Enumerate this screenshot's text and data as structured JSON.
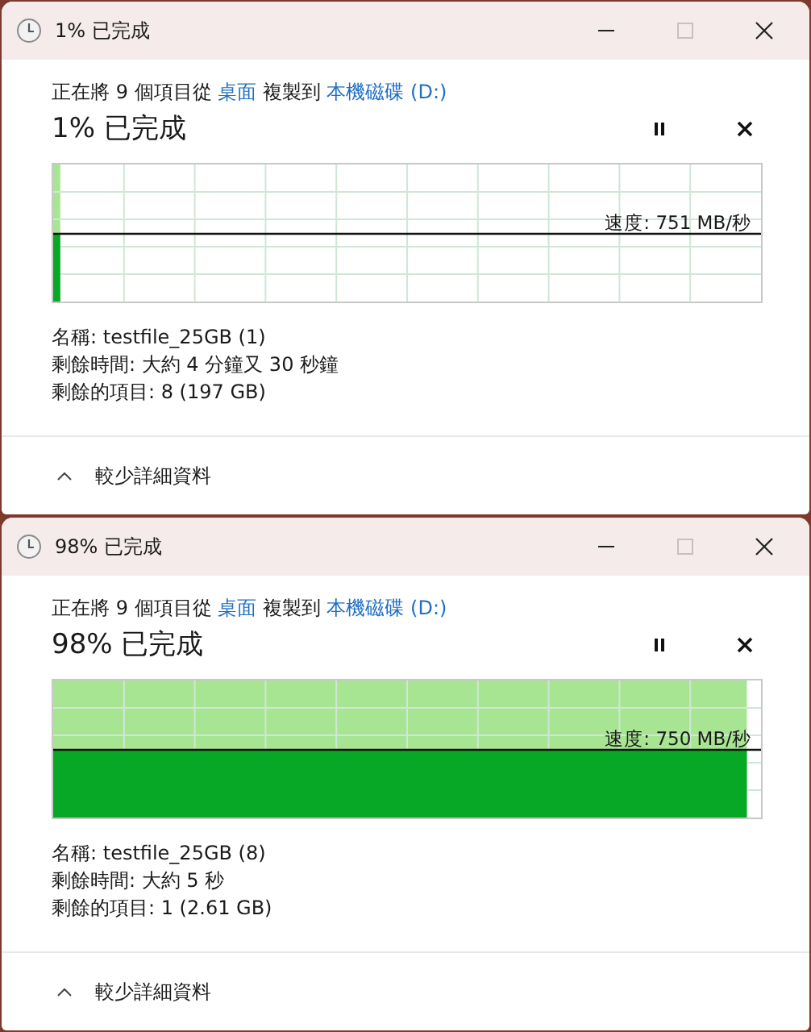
{
  "windows": [
    {
      "title": "1% 已完成",
      "copy_line": [
        {
          "kind": "text",
          "text": "正在將 9 個項目從 "
        },
        {
          "kind": "link",
          "text": "桌面"
        },
        {
          "kind": "text",
          "text": " 複製到 "
        },
        {
          "kind": "link",
          "text": "本機磁碟 (D:)"
        }
      ],
      "heading": "1% 已完成",
      "level": 0.01,
      "speed": "速度: 751 MB/秒",
      "details": [
        "名稱: testfile_25GB (1)",
        "剩餘時間: 大約 4 分鐘又 30 秒鐘",
        "剩餘的項目: 8 (197 GB)"
      ],
      "details_expanded": true,
      "toggle_label": "較少詳細資料"
    },
    {
      "title": "98% 已完成",
      "copy_line": [
        {
          "kind": "text",
          "text": "正在將 9 個項目從 "
        },
        {
          "kind": "link",
          "text": "桌面"
        },
        {
          "kind": "text",
          "text": " 複製到 "
        },
        {
          "kind": "link",
          "text": "本機磁碟 (D:)"
        }
      ],
      "heading": "98% 已完成",
      "level": 0.98,
      "speed": "速度: 750 MB/秒",
      "details": [
        "名稱: testfile_25GB (8)",
        "剩餘時間: 大約 5 秒",
        "剩餘的項目: 1 (2.61 GB)"
      ],
      "details_expanded": true,
      "toggle_label": "較少詳細資料"
    }
  ]
}
